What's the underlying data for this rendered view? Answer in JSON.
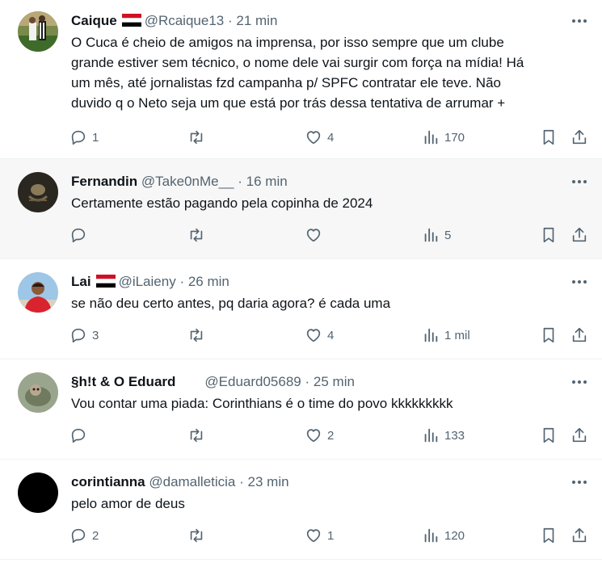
{
  "colors": {
    "text": "#0f1419",
    "muted": "#536471",
    "divider": "#eff3f4",
    "highlight_bg": "#f7f7f7"
  },
  "tweets": [
    {
      "name": "Caique",
      "has_flag": true,
      "handle": "@Rcaique13",
      "separator": "·",
      "time": "21 min",
      "lines": [
        "O Cuca é cheio de amigos na imprensa, por isso sempre que um clube",
        "grande estiver sem técnico, o nome dele vai surgir com força na mídia! Há",
        "um mês, até jornalistas fzd campanha p/ SPFC contratar ele teve. Não",
        "duvido q o Neto seja um que está por trás dessa tentativa de arrumar +"
      ],
      "replies": "1",
      "retweets": "",
      "likes": "4",
      "views": "170"
    },
    {
      "name": "Fernandin",
      "has_flag": false,
      "handle": "@Take0nMe__",
      "separator": "·",
      "time": "16 min",
      "lines": [
        "Certamente estão pagando pela copinha de 2024"
      ],
      "replies": "",
      "retweets": "",
      "likes": "",
      "views": "5"
    },
    {
      "name": "Lai",
      "has_flag": true,
      "handle": "@iLaieny",
      "separator": "·",
      "time": "26 min",
      "lines": [
        "se não deu certo antes, pq daria agora? é cada uma"
      ],
      "replies": "3",
      "retweets": "",
      "likes": "4",
      "views": "1 mil"
    },
    {
      "name": "§h!t & O Eduard",
      "has_flag": false,
      "handle": "@Eduard05689",
      "separator": "·",
      "time": "25 min",
      "lines": [
        "Vou contar uma piada: Corinthians é o time do povo kkkkkkkkk"
      ],
      "replies": "",
      "retweets": "",
      "likes": "2",
      "views": "133"
    },
    {
      "name": "corintianna",
      "has_flag": false,
      "handle": "@damalleticia",
      "separator": "·",
      "time": "23 min",
      "lines": [
        "pelo amor de deus"
      ],
      "replies": "2",
      "retweets": "",
      "likes": "1",
      "views": "120"
    }
  ]
}
